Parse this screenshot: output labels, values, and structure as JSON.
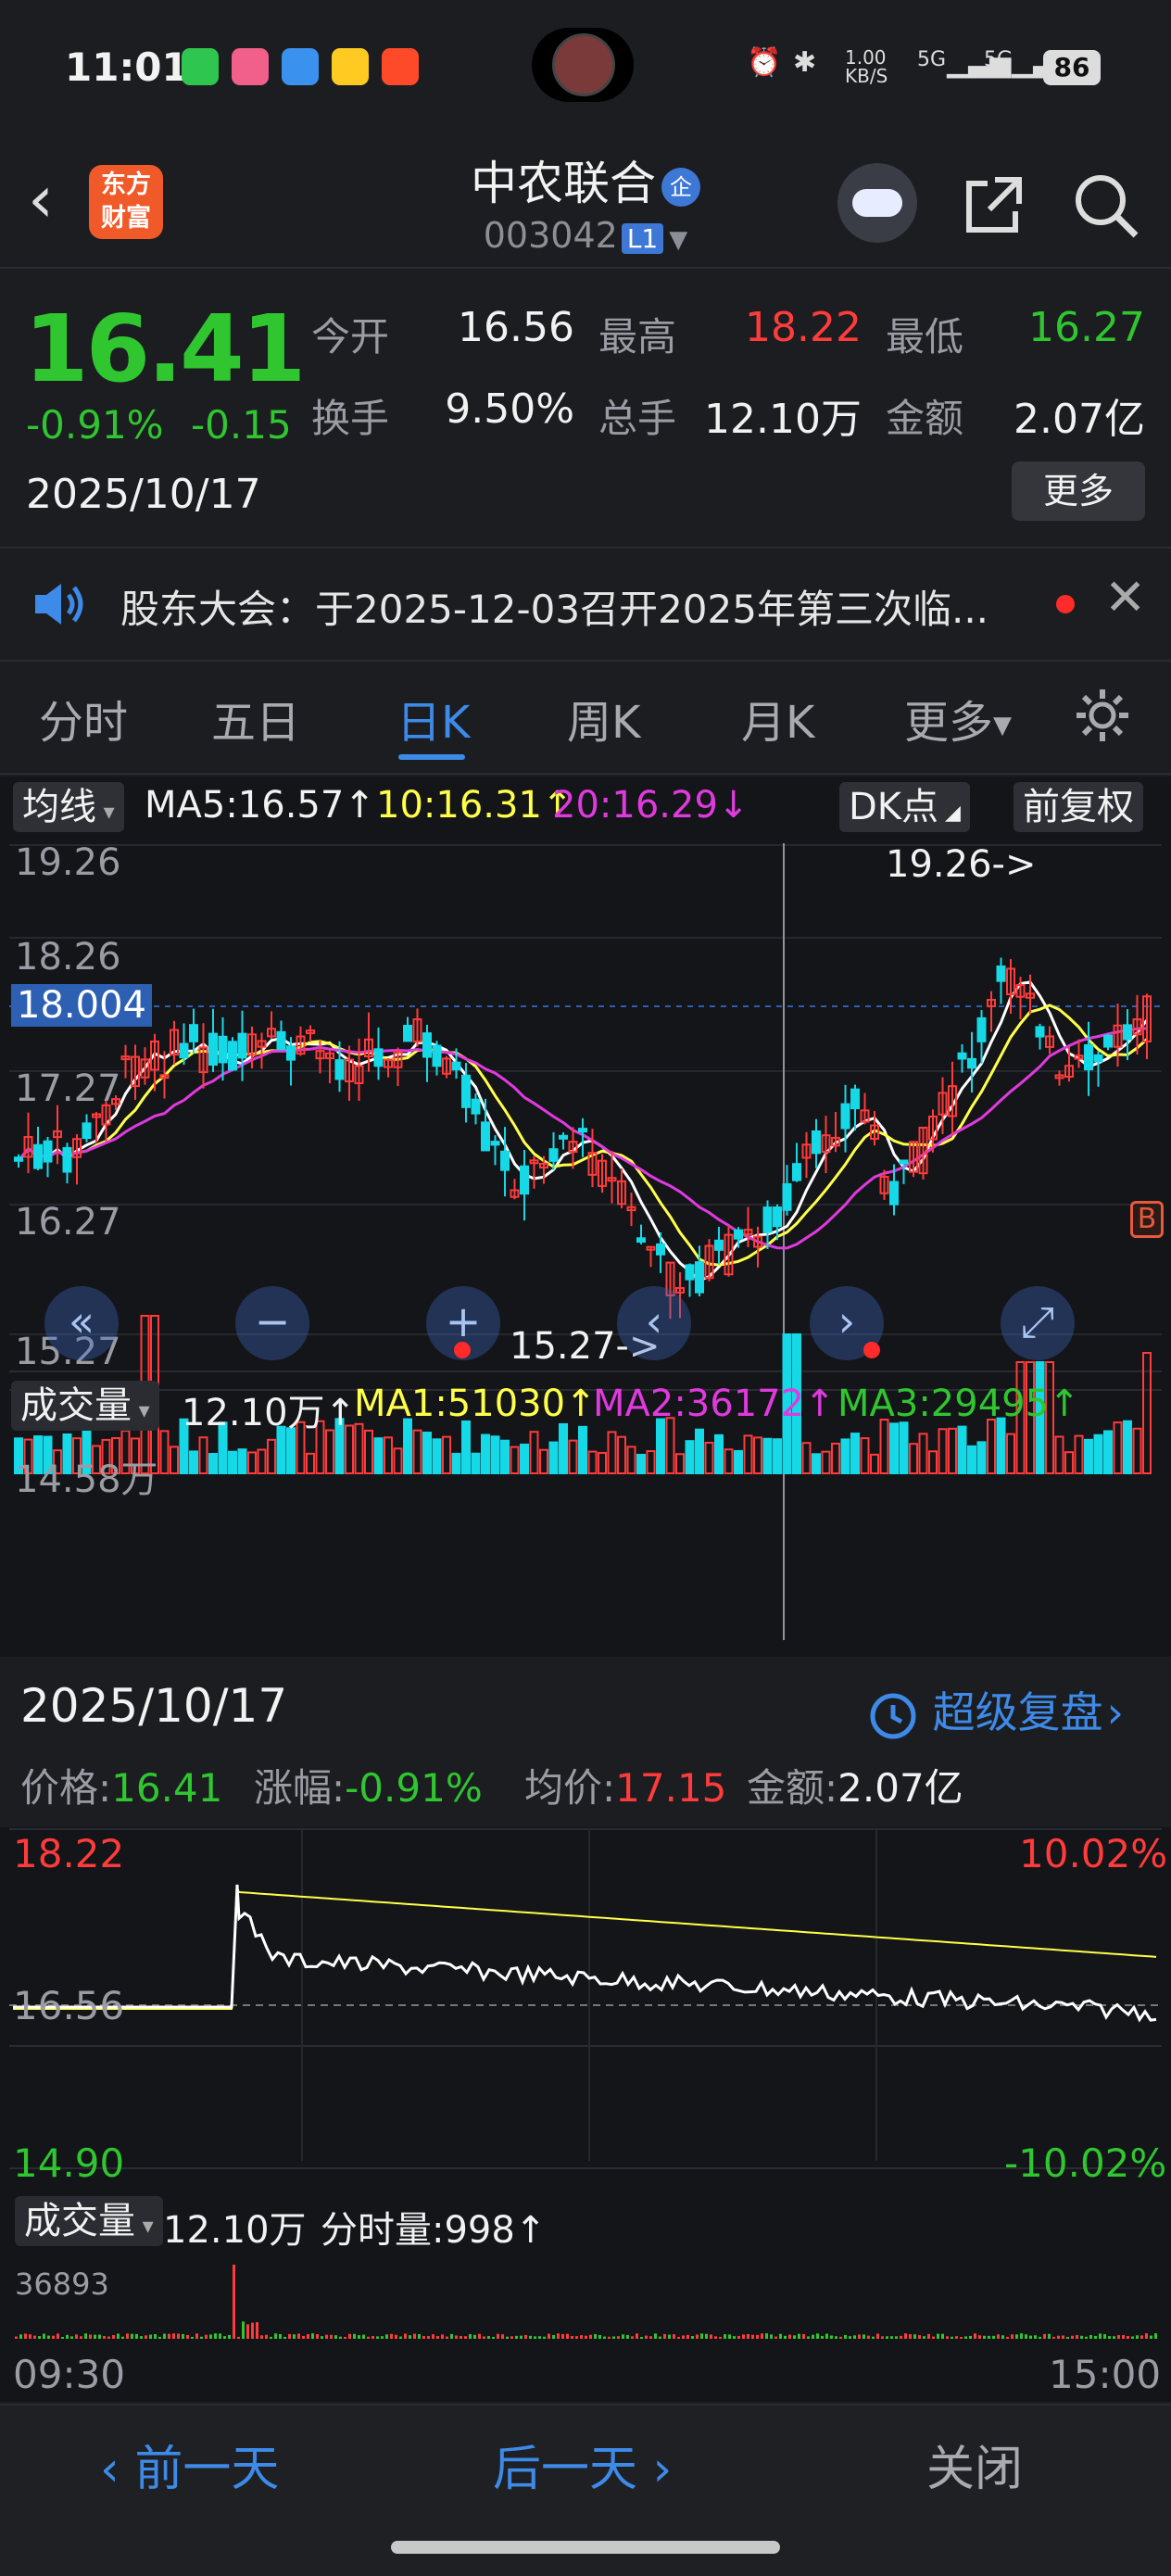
{
  "status_bar": {
    "time": "11:01",
    "net_speed": "1.00\nKB/S",
    "battery": "86",
    "signal1": "5G",
    "signal2": "5G"
  },
  "header": {
    "logo_text": "东方\n财富",
    "stock_name": "中农联合",
    "badge": "企",
    "stock_code": "003042",
    "level": "L1"
  },
  "quote": {
    "price": "16.41",
    "change_pct": "-0.91%",
    "change": "-0.15",
    "date": "2025/10/17",
    "rows": [
      [
        {
          "label": "今开",
          "value": "16.56",
          "color": "#f2f2f2"
        },
        {
          "label": "最高",
          "value": "18.22",
          "color": "#ff3b3b"
        },
        {
          "label": "最低",
          "value": "16.27",
          "color": "#2fc62f"
        }
      ],
      [
        {
          "label": "换手",
          "value": "9.50%",
          "color": "#f2f2f2"
        },
        {
          "label": "总手",
          "value": "12.10万",
          "color": "#f2f2f2"
        },
        {
          "label": "金额",
          "value": "2.07亿",
          "color": "#f2f2f2"
        }
      ]
    ],
    "more_label": "更多"
  },
  "notice": {
    "text": "股东大会：于2025-12-03召开2025年第三次临..."
  },
  "tabs": [
    "分时",
    "五日",
    "日K",
    "周K",
    "月K",
    "更多"
  ],
  "active_tab": "日K",
  "kline": {
    "ma_button": "均线",
    "ma5": "MA5:16.57↑",
    "ma10": "10:16.31↑",
    "ma20": "20:16.29↓",
    "dk_button": "DK点",
    "adjust_button": "前复权",
    "price_labels": [
      "19.26",
      "18.26",
      "17.27",
      "16.27",
      "15.27"
    ],
    "current_tag": "18.004",
    "high_annotation": "19.26->",
    "low_annotation": "15.27->",
    "b_mark": "B",
    "vol_button": "成交量",
    "vol_legend": {
      "total": "12.10万↑",
      "ma1": "MA1:51030↑",
      "ma2": "MA2:36172↑",
      "ma3": "MA3:29495↑"
    },
    "vol_max": "14.58万"
  },
  "intraday": {
    "date": "2025/10/17",
    "replay_label": "超级复盘",
    "price_label": "价格:",
    "price_value": "16.41",
    "change_label": "涨幅:",
    "change_value": "-0.91%",
    "avg_label": "均价:",
    "avg_value": "17.15",
    "amount_label": "金额:",
    "amount_value": "2.07亿",
    "high_price": "18.22",
    "mid_price": "16.56",
    "low_price": "14.90",
    "high_pct": "10.02%",
    "low_pct": "-10.02%",
    "vol_button": "成交量",
    "vol_total": "12.10万",
    "tick_vol": "分时量:998↑",
    "vol_max": "36893",
    "start_time": "09:30",
    "end_time": "15:00"
  },
  "bottom_nav": {
    "prev": "前一天",
    "next": "后一天",
    "close": "关闭"
  },
  "colors": {
    "up": "#ff3b3b",
    "down": "#2fc62f",
    "accent": "#3d8ae8",
    "ma5": "#ffffff",
    "ma10": "#ffff4a",
    "ma20": "#e03adf",
    "bg": "#141519"
  }
}
